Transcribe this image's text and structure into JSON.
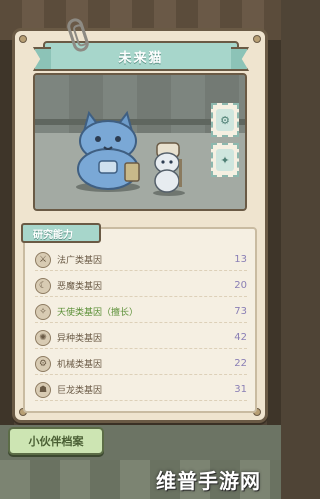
{
  "title": "未来猫",
  "research": {
    "tab_label": "研究能力",
    "genes": [
      {
        "icon": "soldier-gene-icon",
        "name": "法广类基因",
        "value": "13",
        "highlight": false
      },
      {
        "icon": "demon-gene-icon",
        "name": "恶魔类基因",
        "value": "20",
        "highlight": false
      },
      {
        "icon": "angel-gene-icon",
        "name": "天使类基因（擅长）",
        "value": "73",
        "highlight": true
      },
      {
        "icon": "alien-gene-icon",
        "name": "异种类基因",
        "value": "42",
        "highlight": false
      },
      {
        "icon": "machine-gene-icon",
        "name": "机械类基因",
        "value": "22",
        "highlight": false
      },
      {
        "icon": "giant-gene-icon",
        "name": "巨龙类基因",
        "value": "31",
        "highlight": false
      }
    ]
  },
  "footer": {
    "archive_label": "小伙伴档案"
  },
  "watermark": "维普手游网",
  "colors": {
    "card_bg": "#efe4cf",
    "accent_teal": "#a7d6cb",
    "value_purple": "#8a7fb5",
    "button_green": "#cde5b3"
  }
}
